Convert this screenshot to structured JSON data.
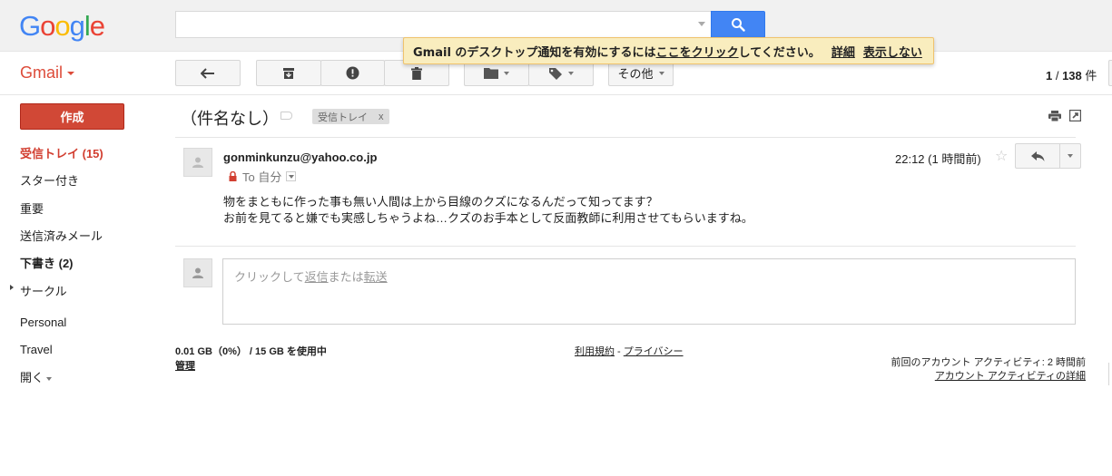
{
  "header": {
    "logo_letters": [
      "G",
      "o",
      "o",
      "g",
      "l",
      "e"
    ],
    "logo_colors": [
      "#4285f4",
      "#ea4335",
      "#fbbc05",
      "#4285f4",
      "#34a853",
      "#ea4335"
    ],
    "search_value": "",
    "search_icon": "search-icon"
  },
  "notification": {
    "prefix": "Gmail のデスクトップ通知を有効にするには",
    "click_link": "ここをクリック",
    "suffix": "してください。",
    "details_link": "詳細",
    "hide_link": "表示しない"
  },
  "app": {
    "gmail_label": "Gmail"
  },
  "toolbar": {
    "back_icon": "arrow-left-icon",
    "archive_icon": "archive-icon",
    "spam_icon": "report-spam-icon",
    "delete_icon": "trash-icon",
    "move_icon": "folder-icon",
    "labels_icon": "label-icon",
    "more_label": "その他",
    "pager_current": "1",
    "pager_sep": " / ",
    "pager_total": "138",
    "pager_unit": " 件"
  },
  "sidebar": {
    "compose_label": "作成",
    "items": [
      {
        "label": "受信トレイ (15)"
      },
      {
        "label": "スター付き"
      },
      {
        "label": "重要"
      },
      {
        "label": "送信済みメール"
      },
      {
        "label": "下書き (2)"
      },
      {
        "label": "サークル"
      },
      {
        "label": "Personal"
      },
      {
        "label": "Travel"
      },
      {
        "label": "開く"
      }
    ]
  },
  "thread": {
    "subject": "（件名なし）",
    "inbox_chip": "受信トレイ",
    "chip_close": "x",
    "message": {
      "sender": "gonminkunzu@yahoo.co.jp",
      "to": "To 自分",
      "time": "22:12 (1 時間前)",
      "star": "☆",
      "body": [
        "物をまともに作った事も無い人間は上から目線のクズになるんだって知ってます？",
        "お前を見てると嫌でも実感しちゃうよね…クズのお手本として反面教師に利用させてもらいますね。"
      ]
    },
    "reply": {
      "prefix": "クリックして",
      "reply_link": "返信",
      "middle": "または",
      "forward_link": "転送"
    }
  },
  "footer": {
    "storage": "0.01 GB（0%） / 15 GB を使用中",
    "manage": "管理",
    "terms": "利用規約",
    "dash": " - ",
    "privacy": "プライバシー",
    "last_activity": "前回のアカウント アクティビティ: 2 時間前",
    "activity_details": "アカウント アクティビティの詳細"
  }
}
